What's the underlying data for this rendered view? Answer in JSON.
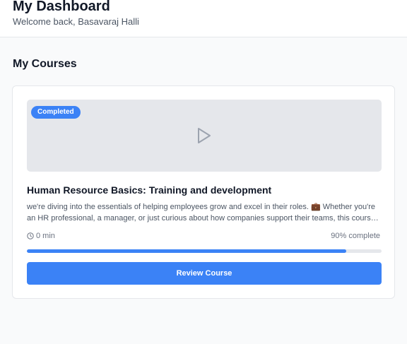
{
  "header": {
    "title": "My Dashboard",
    "subtitle": "Welcome back, Basavaraj Halli"
  },
  "courses_section": {
    "title": "My Courses"
  },
  "course": {
    "status_badge": "Completed",
    "title": "Human Resource Basics: Training and development",
    "description": "we're diving into the essentials of helping employees grow and excel in their roles. 💼 Whether you're an HR professional, a manager, or just curious about how companies support their teams, this course will give you practical insights into training and development.",
    "duration": "0 min",
    "progress_text": "90% complete",
    "progress_fraction": 0.9,
    "button_label": "Review Course",
    "thumbnail_icon": "play-icon",
    "duration_icon": "clock-icon"
  },
  "colors": {
    "accent": "#3b82f6",
    "thumbnail_bg": "#e5e7eb",
    "page_bg": "#f9fafb"
  }
}
